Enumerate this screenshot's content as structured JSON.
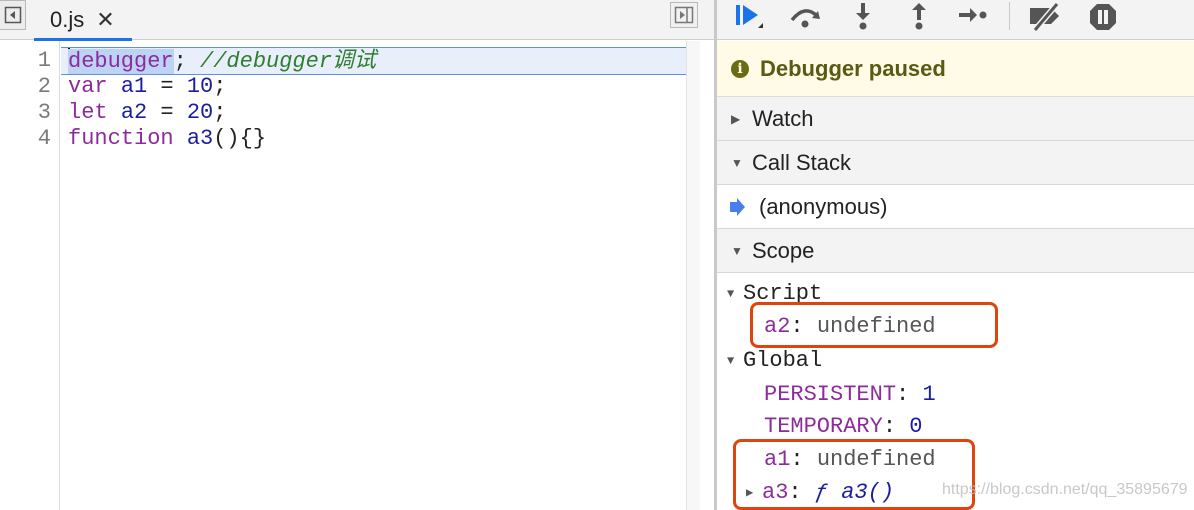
{
  "editor": {
    "tab_label": "0.js",
    "tab_close": "✕",
    "lines": [
      {
        "no": "1",
        "kw": "debugger",
        "rest": "; ",
        "comment": "//debugger调试"
      },
      {
        "no": "2",
        "kw": "var",
        "id": "a1",
        "op": " = ",
        "num": "10",
        "end": ";"
      },
      {
        "no": "3",
        "kw": "let",
        "id": "a2",
        "op": " = ",
        "num": "20",
        "end": ";"
      },
      {
        "no": "4",
        "kw": "function",
        "id": "a3",
        "end": "(){}"
      }
    ]
  },
  "sidebar": {
    "paused_text": "Debugger paused",
    "sections": {
      "watch": "Watch",
      "call_stack": "Call Stack",
      "scope": "Scope"
    },
    "call_stack_frames": [
      "(anonymous)"
    ],
    "scope": {
      "script": {
        "label": "Script",
        "props": [
          {
            "name": "a2",
            "value": "undefined"
          }
        ]
      },
      "global": {
        "label": "Global",
        "props": [
          {
            "name": "PERSISTENT",
            "value": "1"
          },
          {
            "name": "TEMPORARY",
            "value": "0"
          },
          {
            "name": "a1",
            "value": "undefined"
          },
          {
            "name": "a3",
            "value": "ƒ a3()"
          }
        ]
      }
    }
  },
  "watermark": "https://blog.csdn.net/qq_35895679",
  "colors": {
    "accent": "#1a73e8",
    "keyword": "#8d2b9c",
    "number": "#1c1ca3",
    "comment": "#2f7e2f",
    "paused_bg": "#fffbe6",
    "annotation_box": "#e0440e"
  }
}
